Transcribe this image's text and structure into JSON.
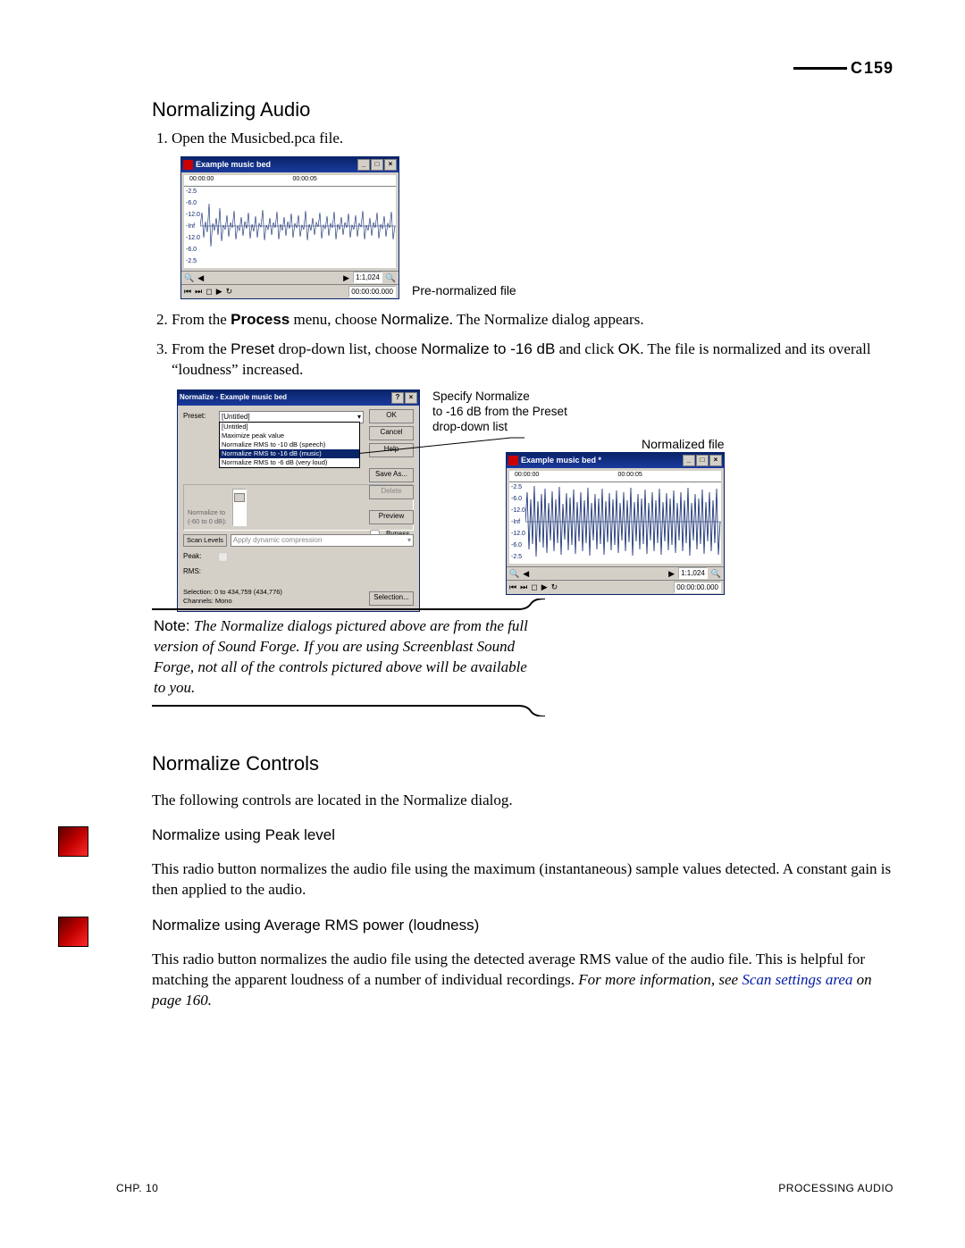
{
  "page_number": "159",
  "section_normalizing": "Normalizing Audio",
  "step1": "Open the Musicbed.pca file.",
  "fig1_caption": "Pre-normalized file",
  "waveform_window": {
    "title": "Example music bed",
    "time_left": "00:00:00",
    "time_right": "00:00:05",
    "db_scale": [
      "-2.5",
      "-6.0",
      "-12.0",
      "-Inf",
      "-12.0",
      "-6.0",
      "-2.5"
    ],
    "status_zoom": "1:1,024",
    "toolbar_time": "00:00:00.000"
  },
  "step2_a": "From the ",
  "step2_b": "Process",
  "step2_c": " menu, choose ",
  "step2_d": "Normalize",
  "step2_e": ". The Normalize dialog appears.",
  "step3_a": "From the ",
  "step3_b": "Preset",
  "step3_c": " drop-down list, choose ",
  "step3_d": "Normalize to -16 dB",
  "step3_e": " and click ",
  "step3_f": "OK",
  "step3_g": ". The file is normalized and its overall “loudness” increased.",
  "dialog": {
    "title": "Normalize - Example music bed",
    "preset_label": "Preset:",
    "preset_value": "[Untitled]",
    "options": [
      "[Untitled]",
      "Maximize peak value",
      "Normalize RMS to -10 dB (speech)",
      "Normalize RMS to -16 dB (music)",
      "Normalize RMS to -6 dB (very loud)"
    ],
    "selected_index": 3,
    "buttons": {
      "ok": "OK",
      "cancel": "Cancel",
      "help": "Help",
      "save_as": "Save As...",
      "delete": "Delete",
      "preview": "Preview",
      "bypass": "Bypass",
      "selection": "Selection..."
    },
    "normalize_label_a": "Normalize to",
    "normalize_label_b": "(-60 to 0 dB):",
    "scan_levels": "Scan Levels",
    "scan_combo": "Apply dynamic compression",
    "peak_label": "Peak:",
    "rms_label": "RMS:",
    "selection_text": "Selection:  0 to 434,759 (434,776)",
    "channels_text": "Channels:  Mono"
  },
  "annot_specify_a": "Specify Normalize",
  "annot_specify_b": "to -16 dB from the Preset",
  "annot_specify_c": "drop-down list",
  "annot_normalized_file": "Normalized file",
  "waveform_window2": {
    "title": "Example music bed *",
    "time_left": "00:00:00",
    "time_right": "00:00:05",
    "db_scale": [
      "-2.5",
      "-6.0",
      "-12.0",
      "-Inf",
      "-12.0",
      "-6.0",
      "-2.5"
    ],
    "status_zoom": "1:1,024",
    "toolbar_time": "00:00:00.000"
  },
  "note_label": "Note:",
  "note_body": " The Normalize dialogs pictured above are from the full version of Sound Forge. If you are using Screenblast Sound Forge, not all of the controls pictured above will be available to you.",
  "section_controls": "Normalize Controls",
  "controls_intro": "The following controls are located in the Normalize dialog.",
  "sub_peak": "Normalize using Peak level",
  "peak_body": "This radio button normalizes the audio file using the maximum (instantaneous) sample values detected. A constant gain is then applied to the audio.",
  "sub_rms": "Normalize using Average RMS power (loudness)",
  "rms_body_a": "This radio button normalizes the audio file using the detected average RMS value of the audio file. This is helpful for matching the apparent loudness of a number of individual recordings. ",
  "rms_more": "For more information, see ",
  "rms_link": "Scan settings area",
  "rms_body_b": " on page 160.",
  "footer_left": "CHP. 10",
  "footer_right": "PROCESSING AUDIO"
}
